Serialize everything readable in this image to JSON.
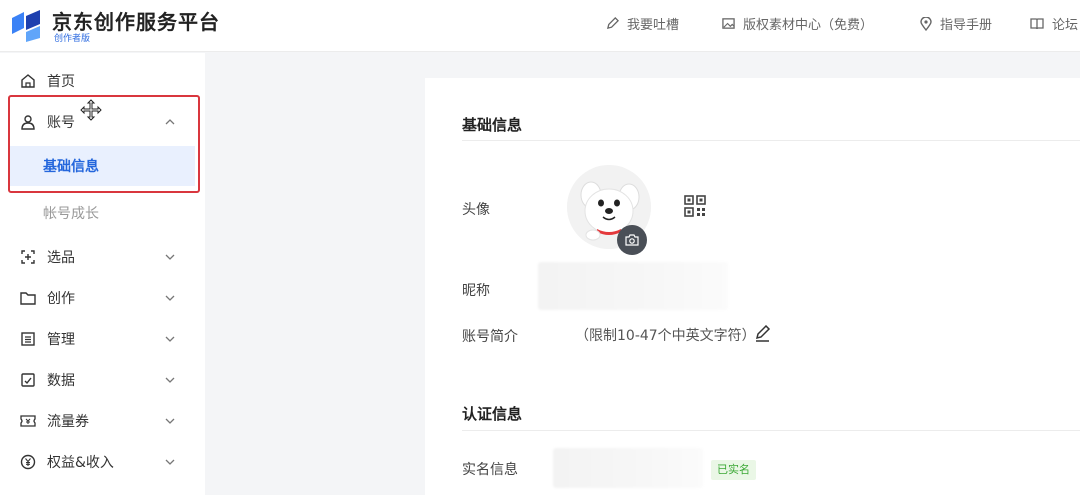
{
  "header": {
    "brand_title": "京东创作服务平台",
    "brand_subtitle": "创作者版",
    "links": [
      {
        "label": "我要吐槽",
        "icon": "pen-icon"
      },
      {
        "label": "版权素材中心（免费）",
        "icon": "image-icon"
      },
      {
        "label": "指导手册",
        "icon": "location-pin-icon"
      },
      {
        "label": "论坛",
        "icon": "book-icon"
      }
    ]
  },
  "sidebar": {
    "items": [
      {
        "label": "首页",
        "icon": "home-icon"
      },
      {
        "label": "账号",
        "icon": "user-icon",
        "expanded": true
      },
      {
        "label": "选品",
        "icon": "select-product-icon"
      },
      {
        "label": "创作",
        "icon": "folder-icon"
      },
      {
        "label": "管理",
        "icon": "list-icon"
      },
      {
        "label": "数据",
        "icon": "chart-icon"
      },
      {
        "label": "流量券",
        "icon": "ticket-icon"
      },
      {
        "label": "权益&收入",
        "icon": "yen-coin-icon"
      }
    ],
    "account_submenu": [
      {
        "label": "基础信息",
        "active": true
      },
      {
        "label": "帐号成长",
        "active": false
      }
    ]
  },
  "main": {
    "basic_section_title": "基础信息",
    "avatar_label": "头像",
    "nickname_label": "昵称",
    "bio_label": "账号简介",
    "bio_placeholder": "（限制10-47个中英文字符）",
    "verify_section_title": "认证信息",
    "realname_label": "实名信息",
    "realname_status": "已实名"
  },
  "colors": {
    "accent": "#2466dc",
    "highlight_box": "#d9363e",
    "verified": "#3aa834"
  }
}
